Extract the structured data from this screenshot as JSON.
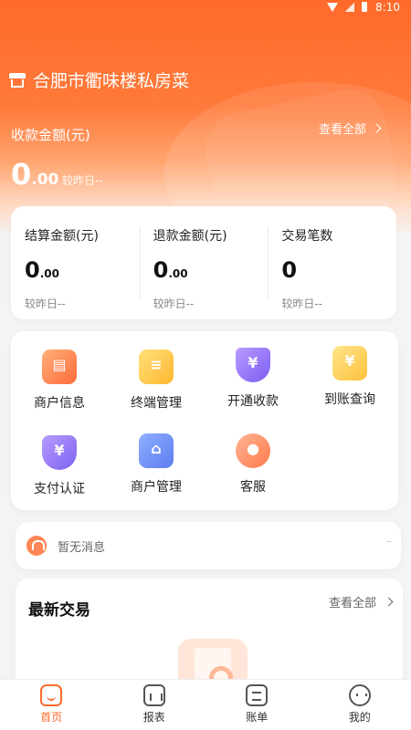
{
  "status_bar": {
    "time": "8:10"
  },
  "header": {
    "store_name": "合肥市衢味楼私房菜",
    "amount_title": "收款金额(元)",
    "view_all": "查看全部",
    "amount_int": "0",
    "amount_dec": ".00",
    "compare": "较昨日--"
  },
  "stats": [
    {
      "label": "结算金额(元)",
      "int": "0",
      "dec": ".00",
      "compare": "较昨日--"
    },
    {
      "label": "退款金额(元)",
      "int": "0",
      "dec": ".00",
      "compare": "较昨日--"
    },
    {
      "label": "交易笔数",
      "int": "0",
      "dec": "",
      "compare": "较昨日--"
    }
  ],
  "functions": [
    {
      "label": "商户信息",
      "icon": "merchant-info-icon"
    },
    {
      "label": "终端管理",
      "icon": "terminal-icon"
    },
    {
      "label": "开通收款",
      "icon": "open-payment-icon"
    },
    {
      "label": "到账查询",
      "icon": "arrival-query-icon"
    },
    {
      "label": "支付认证",
      "icon": "payment-auth-icon"
    },
    {
      "label": "商户管理",
      "icon": "shop-manage-icon"
    },
    {
      "label": "客服",
      "icon": "customer-service-icon"
    }
  ],
  "notice": {
    "text": "暂无消息",
    "extra": "–"
  },
  "latest": {
    "title": "最新交易",
    "view_all": "查看全部"
  },
  "tabs": [
    {
      "label": "首页",
      "icon": "home-icon"
    },
    {
      "label": "报表",
      "icon": "report-icon"
    },
    {
      "label": "账单",
      "icon": "bill-icon"
    },
    {
      "label": "我的",
      "icon": "profile-icon"
    }
  ],
  "colors": {
    "accent": "#ff6a2b"
  }
}
